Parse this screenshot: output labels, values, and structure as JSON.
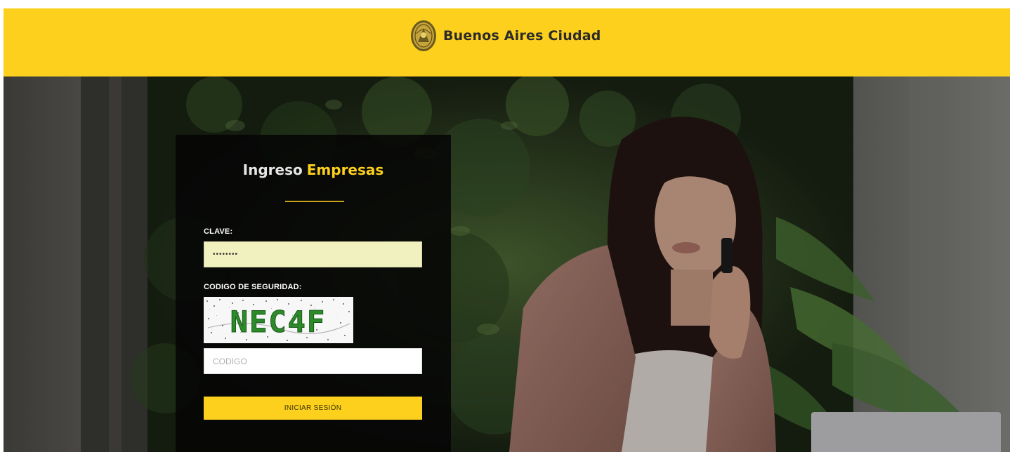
{
  "header": {
    "brand_name": "Buenos Aires Ciudad",
    "logo_icon": "city-seal-icon",
    "background_color": "#fcd01c"
  },
  "login": {
    "title_part1": "Ingreso",
    "title_part2": "Empresas",
    "password_label": "CLAVE:",
    "password_value": "••••••••",
    "security_code_label": "CODIGO DE SEGURIDAD:",
    "captcha_text": "NEC4F",
    "code_placeholder": "CODIGO",
    "submit_label": "INICIAR SESIÓN",
    "accent_color": "#fcd01c",
    "password_field_color": "#f1f1c0"
  }
}
